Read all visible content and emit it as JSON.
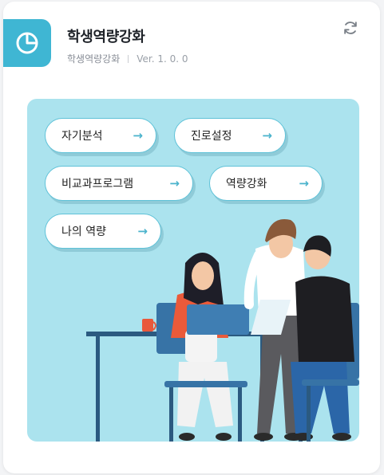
{
  "header": {
    "title": "학생역량강화",
    "subtitle": "학생역량강화",
    "version": "Ver. 1. 0. 0",
    "app_icon": "pie-chart-icon",
    "refresh_icon": "refresh-icon"
  },
  "menu": {
    "items": [
      {
        "label": "자기분석"
      },
      {
        "label": "진로설정"
      },
      {
        "label": "비교과프로그램"
      },
      {
        "label": "역량강화"
      },
      {
        "label": "나의 역량"
      }
    ],
    "arrow": "→"
  },
  "colors": {
    "accent": "#3fb6d3",
    "banner_bg": "#abe3ee",
    "pill_border": "#5fc2d8"
  }
}
